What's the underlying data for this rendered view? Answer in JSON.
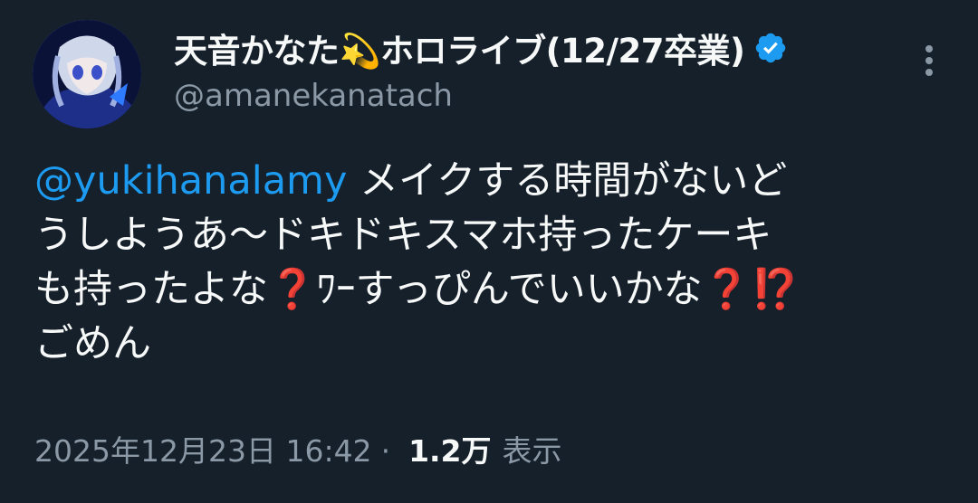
{
  "author": {
    "display_name": "天音かなた💫ホロライブ(12/27卒業)",
    "handle": "@amanekanatach",
    "verified": true
  },
  "tweet": {
    "mention": "@yukihanalamy",
    "line1_text": " メイクする時間がないど",
    "line2": "うしようあ～ドキドキスマホ持ったケーキ",
    "line3_a": "も持ったよな",
    "line3_q1": "❓",
    "line3_b": "ﾜｰすっぴんでいいかな",
    "line3_q2": "❓⁉️",
    "line4": "ごめん"
  },
  "meta": {
    "timestamp": "2025年12月23日 16:42",
    "separator": "·",
    "views_count": "1.2万",
    "views_label": "表示"
  },
  "colors": {
    "background": "#15202b",
    "text_primary": "#f7f9f9",
    "text_secondary": "#8b98a5",
    "mention": "#1d9bf0",
    "verified_badge": "#1d9bf0"
  },
  "icons": [
    "avatar",
    "verified-badge-icon",
    "more-options-icon"
  ]
}
